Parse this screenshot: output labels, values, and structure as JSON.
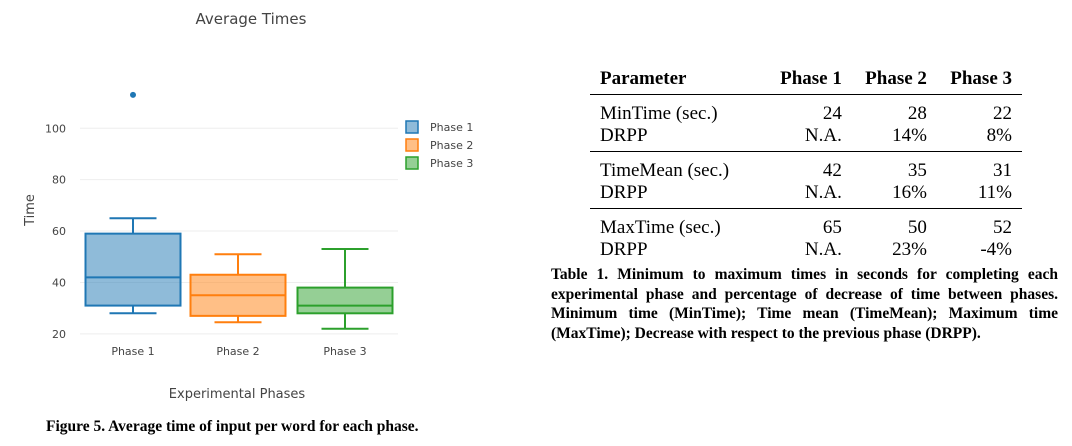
{
  "figure": {
    "caption": "Figure 5. Average time of input per word for each phase."
  },
  "chart_data": {
    "type": "box",
    "title": "Average Times",
    "xlabel": "Experimental Phases",
    "ylabel": "Time",
    "ylim": [
      18,
      118
    ],
    "yticks": [
      20,
      40,
      60,
      80,
      100
    ],
    "grid": true,
    "legend_position": "top-right",
    "categories": [
      "Phase 1",
      "Phase 2",
      "Phase 3"
    ],
    "series": [
      {
        "name": "Phase 1",
        "color": "#1f77b4",
        "min": 28,
        "q1": 31,
        "median": 42,
        "q3": 59,
        "max": 65,
        "outliers": [
          113
        ]
      },
      {
        "name": "Phase 2",
        "color": "#ff7f0e",
        "min": 24.5,
        "q1": 27,
        "median": 35,
        "q3": 43,
        "max": 51,
        "outliers": []
      },
      {
        "name": "Phase 3",
        "color": "#2ca02c",
        "min": 22,
        "q1": 28,
        "median": 31,
        "q3": 38,
        "max": 53,
        "outliers": []
      }
    ]
  },
  "table": {
    "headers": [
      "Parameter",
      "Phase 1",
      "Phase 2",
      "Phase 3"
    ],
    "groups": [
      [
        [
          "MinTime (sec.)",
          "24",
          "28",
          "22"
        ],
        [
          "DRPP",
          "N.A.",
          "14%",
          "8%"
        ]
      ],
      [
        [
          "TimeMean (sec.)",
          "42",
          "35",
          "31"
        ],
        [
          "DRPP",
          "N.A.",
          "16%",
          "11%"
        ]
      ],
      [
        [
          "MaxTime (sec.)",
          "65",
          "50",
          "52"
        ],
        [
          "DRPP",
          "N.A.",
          "23%",
          "-4%"
        ]
      ]
    ],
    "caption": "Table 1. Minimum to maximum times in seconds for completing each experimental phase and percentage of decrease of time between phases. Minimum time (MinTime); Time mean (TimeMean); Maximum time (MaxTime); Decrease with respect to the previous phase (DRPP)."
  }
}
